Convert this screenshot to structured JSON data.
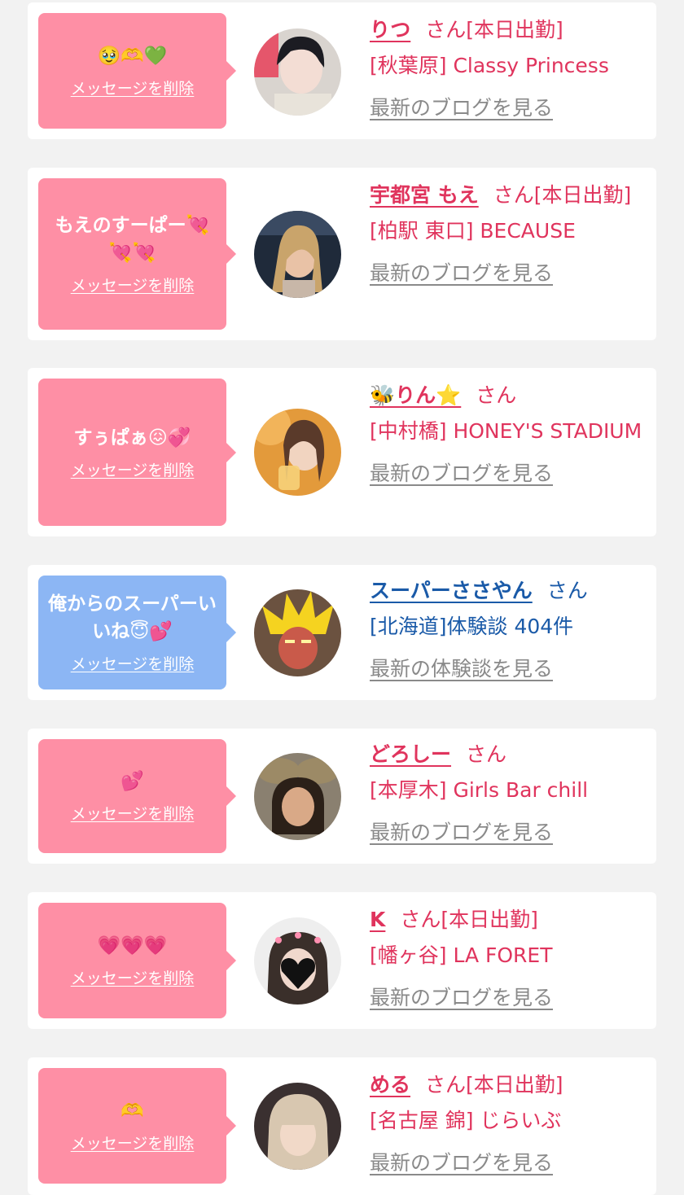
{
  "items": [
    {
      "message": "🥹🫶💚",
      "delete": "メッセージを削除",
      "name": "りつ",
      "suffix": "さん[本日出勤]",
      "shop": "[秋葉原] Classy Princess",
      "link": "最新のブログを見る"
    },
    {
      "message": "もえのすーぱー💘💘💘",
      "delete": "メッセージを削除",
      "name": "宇都宮 もえ",
      "suffix": "さん[本日出勤]",
      "shop": "[柏駅 東口] BECAUSE",
      "link": "最新のブログを見る"
    },
    {
      "message": "すぅぱぁ😖💞",
      "delete": "メッセージを削除",
      "name": "🐝りん⭐",
      "suffix": "さん",
      "shop": "[中村橋] HONEY'S STADIUM",
      "link": "最新のブログを見る"
    },
    {
      "message": "俺からのスーパーいいね😇💕",
      "delete": "メッセージを削除",
      "name": "スーパーささやん",
      "suffix": "さん",
      "shop": "[北海道]体験談 404件",
      "link": "最新の体験談を見る"
    },
    {
      "message": "💕",
      "delete": "メッセージを削除",
      "name": "どろしー",
      "suffix": "さん",
      "shop": "[本厚木] Girls Bar chill",
      "link": "最新のブログを見る"
    },
    {
      "message": "💗💗💗",
      "delete": "メッセージを削除",
      "name": "K",
      "suffix": "さん[本日出勤]",
      "shop": "[幡ヶ谷] LA FORET",
      "link": "最新のブログを見る"
    },
    {
      "message": "🫶",
      "delete": "メッセージを削除",
      "name": "める",
      "suffix": "さん[本日出勤]",
      "shop": "[名古屋 錦] じらいぶ",
      "link": "最新のブログを見る"
    }
  ],
  "colors": {
    "pink": "#fe8fa5",
    "blue": "#8cb6f4",
    "accent": "#e0345d",
    "link_blue": "#1a5aa8",
    "muted": "#8a8a8a"
  }
}
